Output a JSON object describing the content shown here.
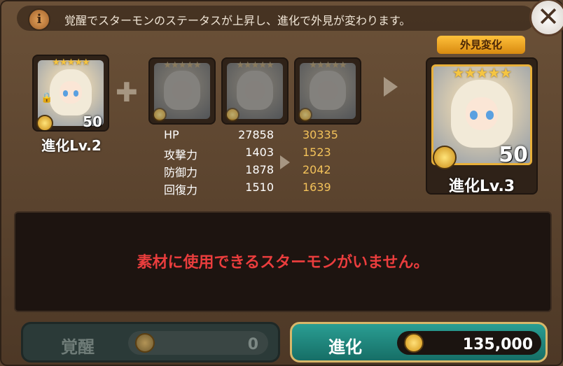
{
  "info": {
    "text": "覚醒でスターモンのステータスが上昇し、進化で外見が変わります。"
  },
  "close_label": "✕",
  "current": {
    "stars": "★★★★★",
    "level": "50",
    "evolution_label": "進化Lv.2"
  },
  "materials": [
    {
      "stars": "★★★★★"
    },
    {
      "stars": "★★★★★"
    },
    {
      "stars": "★★★★★"
    }
  ],
  "result": {
    "tag": "外見変化",
    "stars": "★★★★★",
    "level": "50",
    "evolution_label": "進化Lv.3"
  },
  "stats": [
    {
      "name": "HP",
      "current": "27858",
      "next": "30335"
    },
    {
      "name": "攻撃力",
      "current": "1403",
      "next": "1523"
    },
    {
      "name": "防御力",
      "current": "1878",
      "next": "2042"
    },
    {
      "name": "回復力",
      "current": "1510",
      "next": "1639"
    }
  ],
  "message": "素材に使用できるスターモンがいません。",
  "buttons": {
    "awaken": {
      "label": "覚醒",
      "cost": "0"
    },
    "evolve": {
      "label": "進化",
      "cost": "135,000"
    }
  },
  "colors": {
    "accent_gold": "#f3c25a",
    "warning_red": "#ea3d3d",
    "evolve_teal": "#2a9e93"
  }
}
